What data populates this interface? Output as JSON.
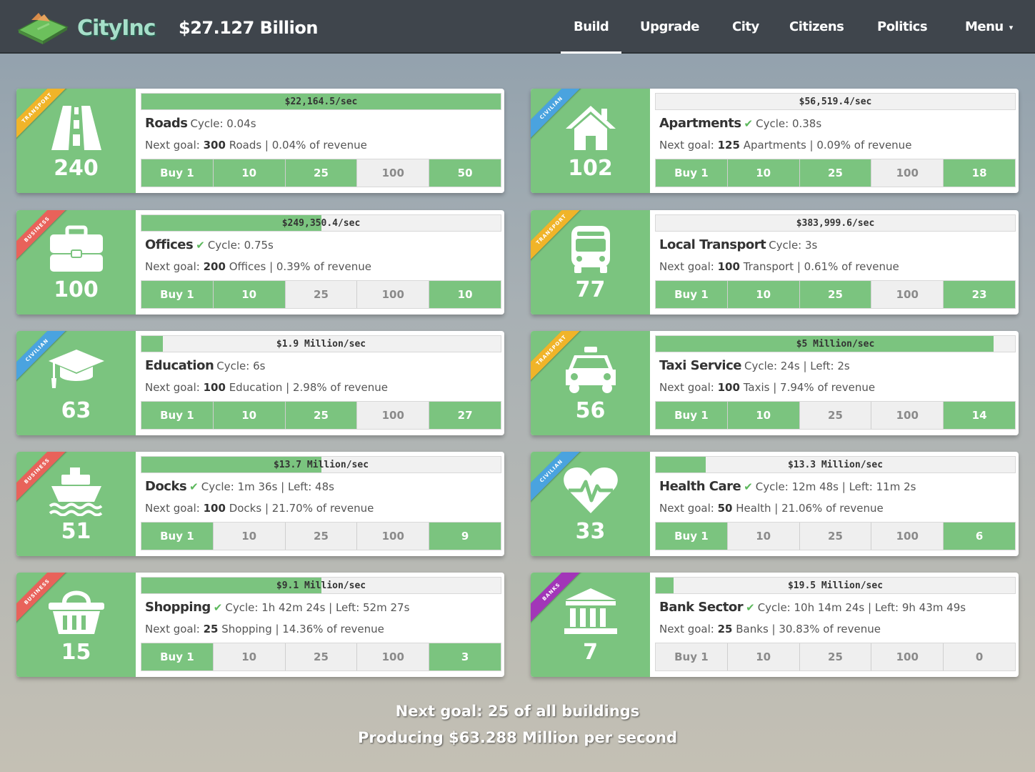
{
  "header": {
    "brand": "CityInc",
    "money": "$27.127 Billion",
    "nav": [
      {
        "label": "Build",
        "active": true
      },
      {
        "label": "Upgrade",
        "active": false
      },
      {
        "label": "City",
        "active": false
      },
      {
        "label": "Citizens",
        "active": false
      },
      {
        "label": "Politics",
        "active": false
      },
      {
        "label": "Menu",
        "active": false
      }
    ],
    "menu_caret": "▾"
  },
  "buy_labels": [
    "Buy 1",
    "10",
    "25",
    "100"
  ],
  "cards": [
    {
      "id": "roads",
      "category": "TRANSPORT",
      "category_color": "#f0b429",
      "icon": "road-icon",
      "count": "240",
      "rate": "$22,164.5/sec",
      "progress": 1.0,
      "name": "Roads",
      "check": false,
      "cycle": "Cycle: 0.04s",
      "goal_prefix": "Next goal:",
      "goal_num": "300",
      "goal_rest": "Roads | 0.04% of revenue",
      "buy_states": [
        true,
        true,
        true,
        false
      ],
      "max": "50",
      "max_on": true
    },
    {
      "id": "apartments",
      "category": "CIVILIAN",
      "category_color": "#4aa3df",
      "icon": "house-icon",
      "count": "102",
      "rate": "$56,519.4/sec",
      "progress": 0.0,
      "name": "Apartments",
      "check": true,
      "cycle": "Cycle: 0.38s",
      "goal_prefix": "Next goal:",
      "goal_num": "125",
      "goal_rest": "Apartments | 0.09% of revenue",
      "buy_states": [
        true,
        true,
        true,
        false
      ],
      "max": "18",
      "max_on": true
    },
    {
      "id": "offices",
      "category": "BUSINESS",
      "category_color": "#e8625a",
      "icon": "briefcase-icon",
      "count": "100",
      "rate": "$249,350.4/sec",
      "progress": 0.5,
      "name": "Offices",
      "check": true,
      "cycle": "Cycle: 0.75s",
      "goal_prefix": "Next goal:",
      "goal_num": "200",
      "goal_rest": "Offices | 0.39% of revenue",
      "buy_states": [
        true,
        true,
        false,
        false
      ],
      "max": "10",
      "max_on": true
    },
    {
      "id": "local-transport",
      "category": "TRANSPORT",
      "category_color": "#f0b429",
      "icon": "bus-icon",
      "count": "77",
      "rate": "$383,999.6/sec",
      "progress": 0.0,
      "name": "Local Transport",
      "check": false,
      "cycle": "Cycle: 3s",
      "goal_prefix": "Next goal:",
      "goal_num": "100",
      "goal_rest": "Transport | 0.61% of revenue",
      "buy_states": [
        true,
        true,
        true,
        false
      ],
      "max": "23",
      "max_on": true
    },
    {
      "id": "education",
      "category": "CIVILIAN",
      "category_color": "#4aa3df",
      "icon": "graduation-cap-icon",
      "count": "63",
      "rate": "$1.9 Million/sec",
      "progress": 0.06,
      "name": "Education",
      "check": false,
      "cycle": "Cycle: 6s",
      "goal_prefix": "Next goal:",
      "goal_num": "100",
      "goal_rest": "Education | 2.98% of revenue",
      "buy_states": [
        true,
        true,
        true,
        false
      ],
      "max": "27",
      "max_on": true
    },
    {
      "id": "taxi-service",
      "category": "TRANSPORT",
      "category_color": "#f0b429",
      "icon": "taxi-icon",
      "count": "56",
      "rate": "$5 Million/sec",
      "progress": 0.94,
      "name": "Taxi Service",
      "check": false,
      "cycle": "Cycle: 24s | Left: 2s",
      "goal_prefix": "Next goal:",
      "goal_num": "100",
      "goal_rest": "Taxis | 7.94% of revenue",
      "buy_states": [
        true,
        true,
        false,
        false
      ],
      "max": "14",
      "max_on": true
    },
    {
      "id": "docks",
      "category": "BUSINESS",
      "category_color": "#e8625a",
      "icon": "ship-icon",
      "count": "51",
      "rate": "$13.7 Million/sec",
      "progress": 0.5,
      "name": "Docks",
      "check": true,
      "cycle": "Cycle: 1m 36s | Left: 48s",
      "goal_prefix": "Next goal:",
      "goal_num": "100",
      "goal_rest": "Docks | 21.70% of revenue",
      "buy_states": [
        true,
        false,
        false,
        false
      ],
      "max": "9",
      "max_on": true
    },
    {
      "id": "health-care",
      "category": "CIVILIAN",
      "category_color": "#4aa3df",
      "icon": "heart-pulse-icon",
      "count": "33",
      "rate": "$13.3 Million/sec",
      "progress": 0.14,
      "name": "Health Care",
      "check": true,
      "cycle": "Cycle: 12m 48s | Left: 11m 2s",
      "goal_prefix": "Next goal:",
      "goal_num": "50",
      "goal_rest": "Health | 21.06% of revenue",
      "buy_states": [
        true,
        false,
        false,
        false
      ],
      "max": "6",
      "max_on": true
    },
    {
      "id": "shopping",
      "category": "BUSINESS",
      "category_color": "#e8625a",
      "icon": "basket-icon",
      "count": "15",
      "rate": "$9.1 Million/sec",
      "progress": 0.5,
      "name": "Shopping",
      "check": true,
      "cycle": "Cycle: 1h 42m 24s | Left: 52m 27s",
      "goal_prefix": "Next goal:",
      "goal_num": "25",
      "goal_rest": "Shopping | 14.36% of revenue",
      "buy_states": [
        true,
        false,
        false,
        false
      ],
      "max": "3",
      "max_on": true
    },
    {
      "id": "bank-sector",
      "category": "BANKS",
      "category_color": "#a236b8",
      "icon": "bank-icon",
      "count": "7",
      "rate": "$19.5 Million/sec",
      "progress": 0.05,
      "name": "Bank Sector",
      "check": true,
      "cycle": "Cycle: 10h 14m 24s | Left: 9h 43m 49s",
      "goal_prefix": "Next goal:",
      "goal_num": "25",
      "goal_rest": "Banks | 30.83% of revenue",
      "buy_states": [
        false,
        false,
        false,
        false
      ],
      "max": "0",
      "max_on": false
    }
  ],
  "footer": {
    "goal": "Next goal: 25 of all buildings",
    "producing": "Producing $63.288 Million per second"
  },
  "colors": {
    "green": "#7bc47f",
    "topbar": "#3f454c",
    "brand": "#a6dfc9"
  }
}
